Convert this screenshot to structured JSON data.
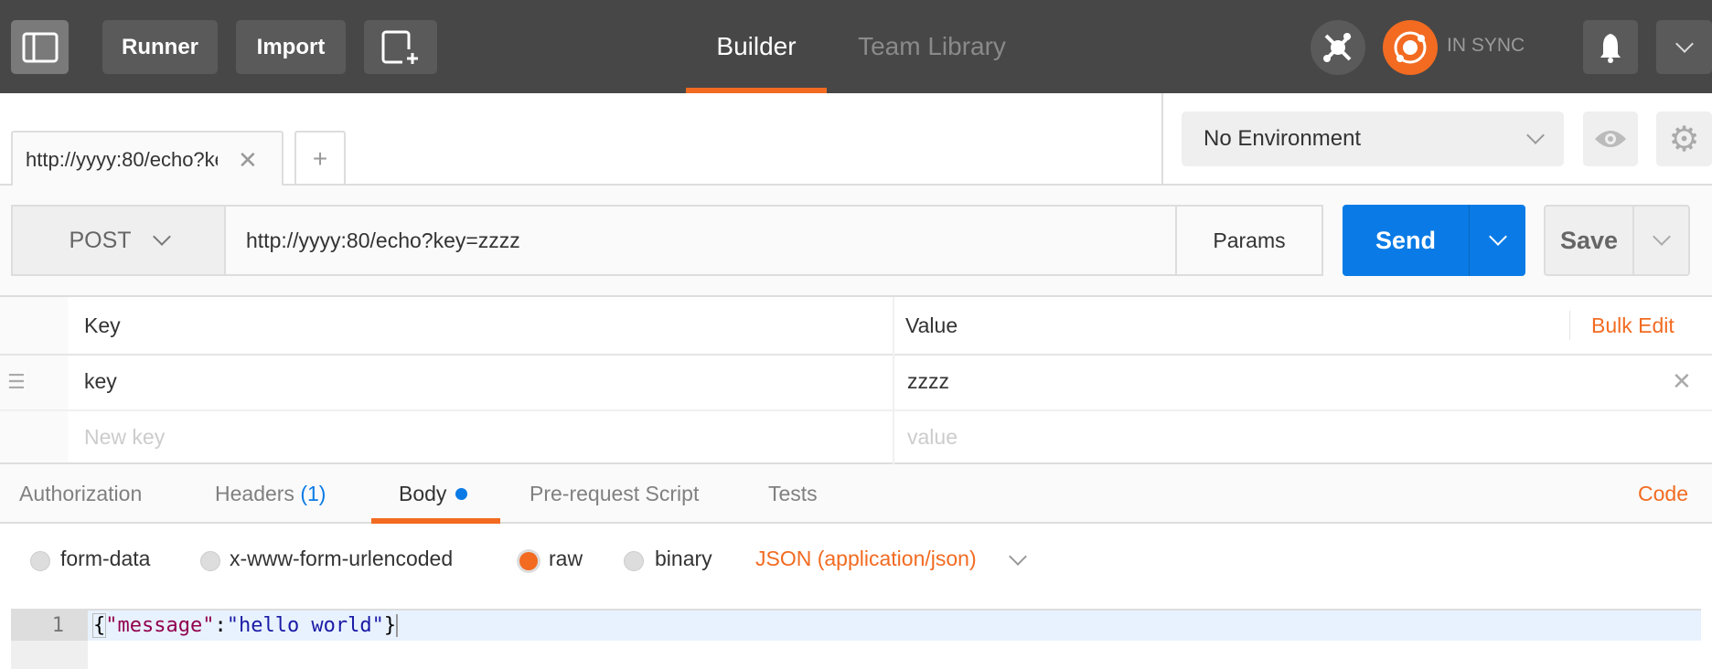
{
  "header": {
    "runner": "Runner",
    "import": "Import",
    "nav_tabs": [
      "Builder",
      "Team Library"
    ],
    "sync_status": "IN SYNC"
  },
  "request_tabs": {
    "active_tab": "http://yyyy:80/echo?kе",
    "add_tab": "+"
  },
  "environment": {
    "selected": "No Environment"
  },
  "request": {
    "method": "POST",
    "url": "http://yyyy:80/echo?key=zzzz",
    "params_label": "Params",
    "send_label": "Send",
    "save_label": "Save"
  },
  "params_table": {
    "headers": {
      "key": "Key",
      "value": "Value",
      "bulk_edit": "Bulk Edit"
    },
    "rows": [
      {
        "key": "key",
        "value": "zzzz"
      }
    ],
    "new_row": {
      "key_placeholder": "New key",
      "value_placeholder": "value"
    }
  },
  "section_tabs": {
    "authorization": "Authorization",
    "headers": "Headers",
    "headers_count": "(1)",
    "body": "Body",
    "pre_request": "Pre-request Script",
    "tests": "Tests",
    "code": "Code"
  },
  "body": {
    "modes": [
      "form-data",
      "x-www-form-urlencoded",
      "raw",
      "binary"
    ],
    "selected_mode": "raw",
    "content_type": "JSON (application/json)",
    "editor": {
      "line_number": "1",
      "open_brace": "{",
      "key": "\"message\"",
      "colon": ":",
      "value": "\"hello world\"",
      "close_brace": "}"
    }
  },
  "colors": {
    "accent": "#f26b21",
    "send": "#0a7be6",
    "topbar": "#474747",
    "link_blue": "#0a7be6"
  }
}
